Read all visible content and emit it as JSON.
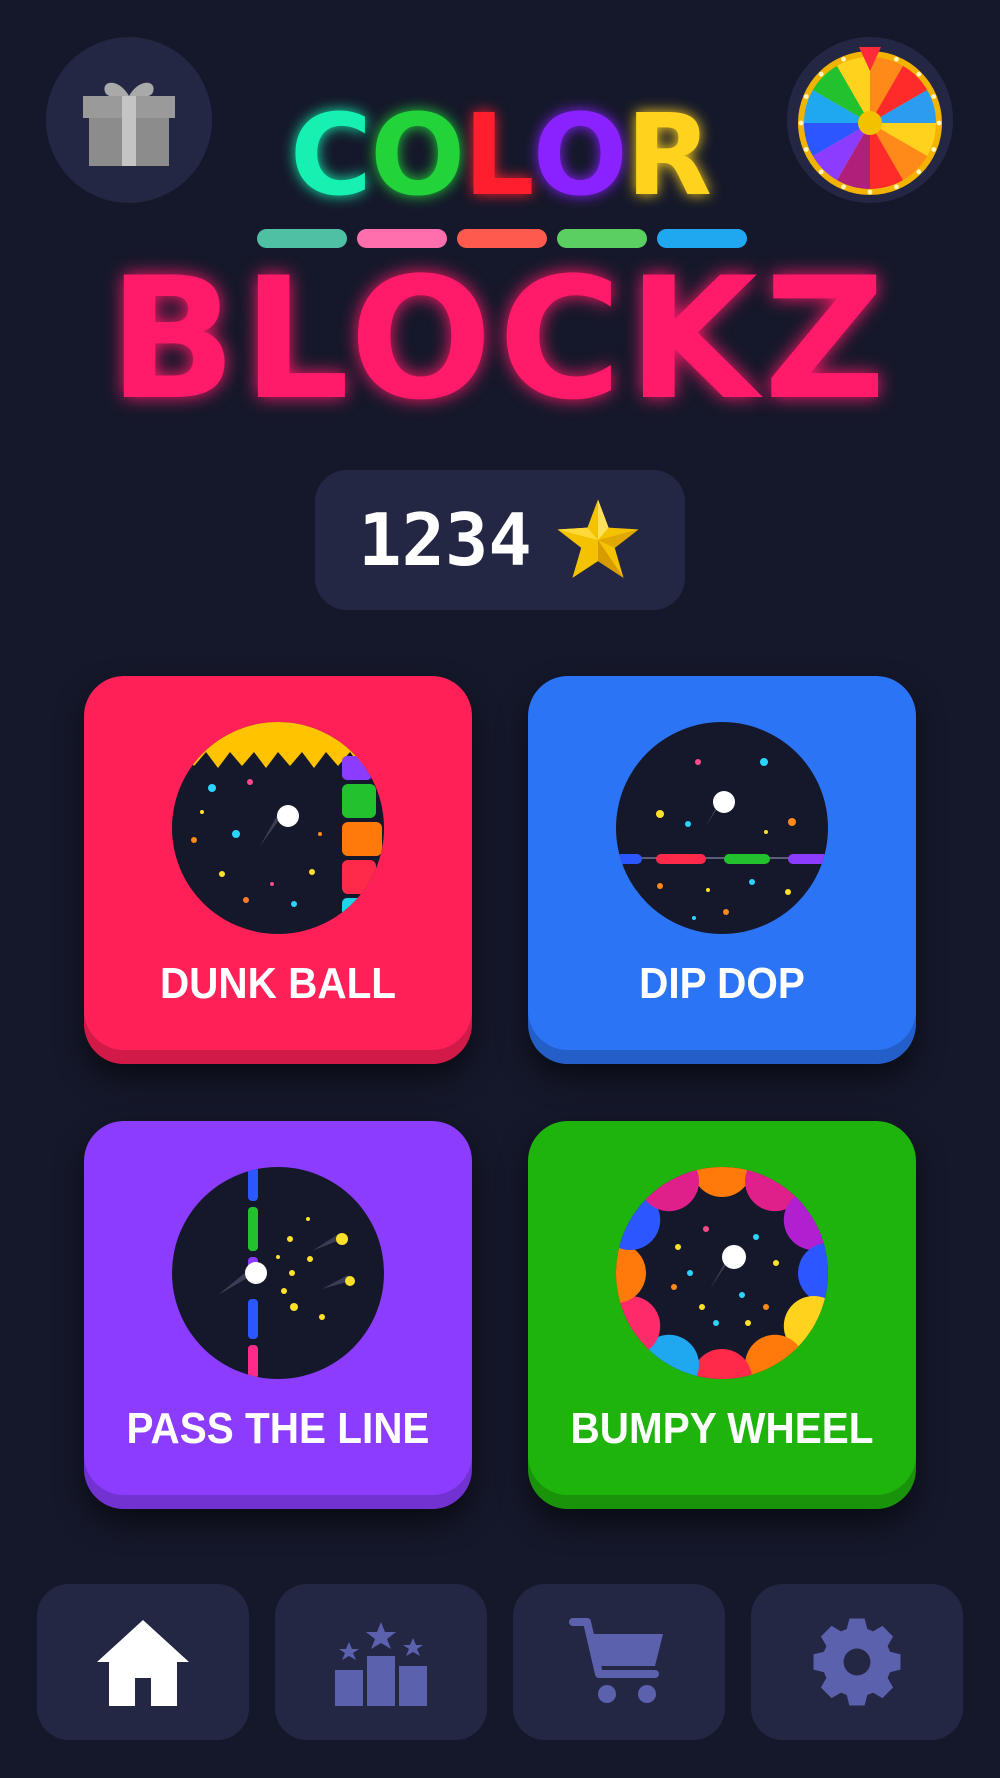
{
  "header": {
    "gift_icon": "gift-icon",
    "wheel_icon": "prize-wheel-icon"
  },
  "logo": {
    "color_letters": [
      {
        "char": "C",
        "color": "#16f0b0"
      },
      {
        "char": "O",
        "color": "#22d43a"
      },
      {
        "char": "L",
        "color": "#ff1e2e"
      },
      {
        "char": "O",
        "color": "#8a22ff"
      },
      {
        "char": "R",
        "color": "#ffd21e"
      }
    ],
    "bar_colors": [
      "#4fc0a4",
      "#ff6fae",
      "#ff5a4e",
      "#5ccf62",
      "#1fa8f0"
    ],
    "blockz": "BLOCKZ",
    "blockz_color": "#ff1a6a"
  },
  "score": {
    "value": "1234",
    "icon": "star-icon"
  },
  "games": [
    {
      "label": "DUNK BALL",
      "color": "#ff2058"
    },
    {
      "label": "DIP DOP",
      "color": "#2c74f6"
    },
    {
      "label": "PASS THE LINE",
      "color": "#8b3cff"
    },
    {
      "label": "BUMPY WHEEL",
      "color": "#1fb40c"
    }
  ],
  "nav": [
    {
      "icon": "home-icon",
      "active": true
    },
    {
      "icon": "leaderboard-icon",
      "active": false
    },
    {
      "icon": "cart-icon",
      "active": false
    },
    {
      "icon": "gear-icon",
      "active": false
    }
  ]
}
